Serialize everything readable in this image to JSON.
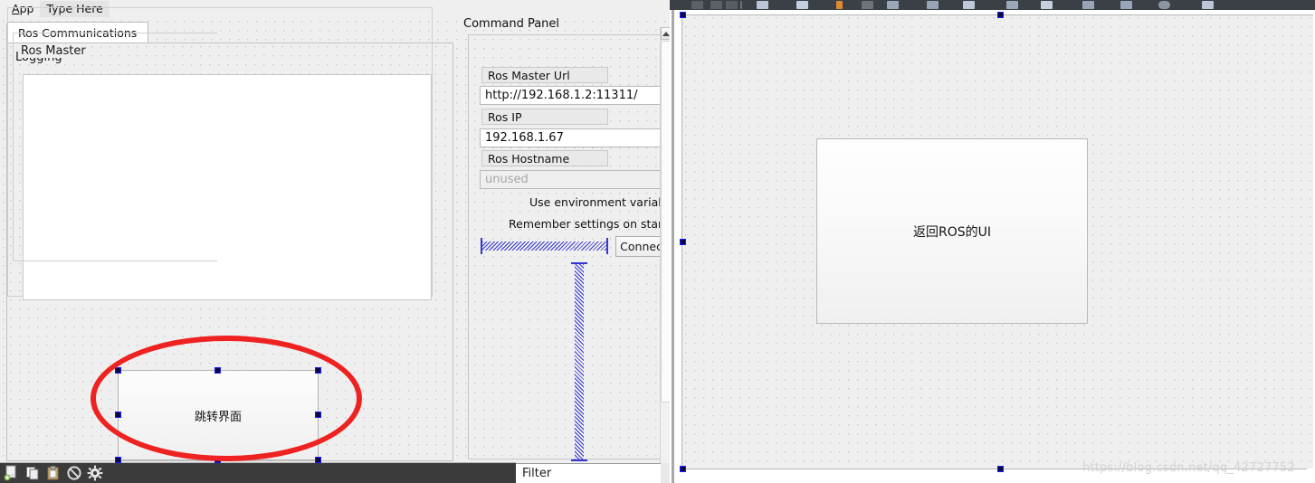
{
  "menubar": {
    "app_label": "App",
    "app_mnemonic": "A",
    "app_rest": "pp",
    "type_here_label": "Type Here"
  },
  "left_form": {
    "tab": {
      "label": "Ros Communications"
    },
    "logging_group": {
      "title": "Logging"
    },
    "jump_button": {
      "label": "跳转界面"
    },
    "annotation": {
      "shape": "red-ellipse-highlight"
    }
  },
  "command_panel": {
    "title": "Command Panel",
    "ros_master_group": {
      "title": "Ros Master",
      "fields": [
        {
          "label": "Ros Master Url",
          "value": "http://192.168.1.2:11311/",
          "placeholder": ""
        },
        {
          "label": "Ros IP",
          "value": "192.168.1.67",
          "placeholder": ""
        },
        {
          "label": "Ros Hostname",
          "value": "",
          "placeholder": "unused"
        }
      ],
      "checkboxes": [
        {
          "label": "Use environment variable"
        },
        {
          "label": "Remember settings on startup"
        }
      ],
      "connect_button": {
        "label": "Connect"
      }
    }
  },
  "bottom_toolbar": {
    "icons": [
      {
        "name": "new-document-icon"
      },
      {
        "name": "copy-icon"
      },
      {
        "name": "paste-icon"
      },
      {
        "name": "forbidden-icon"
      },
      {
        "name": "gear-icon"
      }
    ],
    "filter": {
      "label": "Filter"
    }
  },
  "right_form": {
    "return_button": {
      "label": "返回ROS的UI"
    },
    "toolbar": {
      "name": "designer-toolbar"
    }
  },
  "watermark": {
    "text": "https://blog.csdn.net/qq_42727752"
  },
  "colors": {
    "canvas_bg": "#efefef",
    "grid_dot": "#c9c9c9",
    "selection_handle_fill": "#0a0a3c",
    "selection_handle_border": "#1a1aff",
    "annotation_red": "#ef2222",
    "spacer_blue": "#3535cf",
    "toolbar_dark": "#3b3b3b",
    "designer_toolbar_dark": "#3b4047"
  }
}
